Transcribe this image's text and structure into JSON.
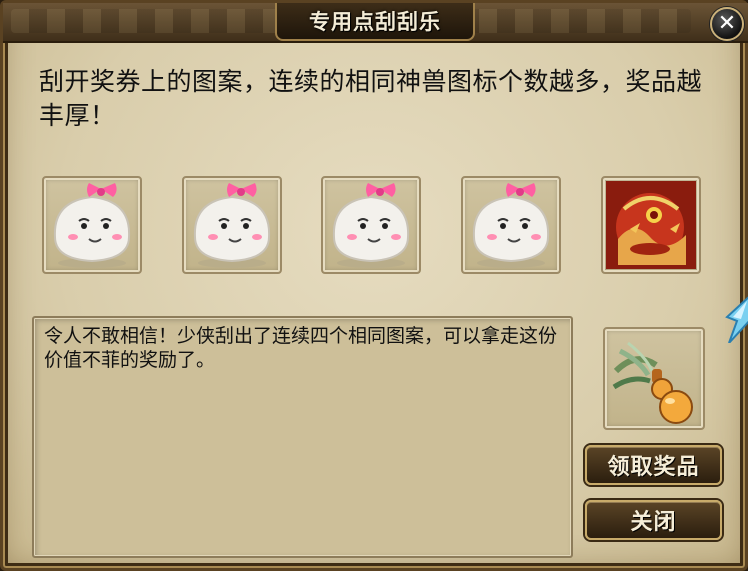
{
  "dialog": {
    "title": "专用点刮刮乐",
    "close_label": "✕"
  },
  "instructions": "刮开奖券上的图案，连续的相同神兽图标个数越多，奖品越丰厚！",
  "slots": [
    {
      "icon": "bunny-bun-icon"
    },
    {
      "icon": "bunny-bun-icon"
    },
    {
      "icon": "bunny-bun-icon"
    },
    {
      "icon": "bunny-bun-icon"
    },
    {
      "icon": "red-beast-icon"
    }
  ],
  "message": "令人不敢相信！少侠刮出了连续四个相同图案，可以拿走这份价值不菲的奖励了。",
  "reward": {
    "icon": "gourd-with-leaves-icon"
  },
  "buttons": {
    "claim": "领取奖品",
    "close": "关闭"
  },
  "colors": {
    "panel_bg": "#d9cdab",
    "frame": "#5a4222",
    "button_bg": "#3d2d18",
    "button_text": "#f6eed8"
  }
}
